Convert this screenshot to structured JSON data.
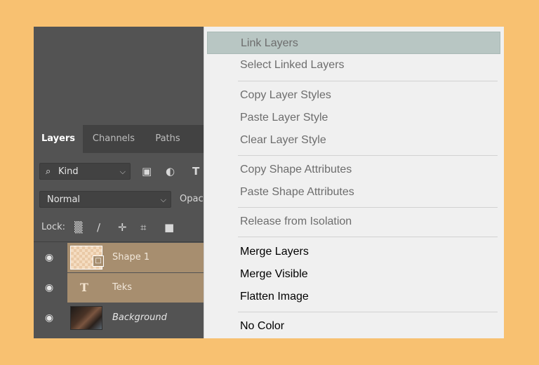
{
  "panel": {
    "tabs": [
      {
        "label": "Layers",
        "active": true
      },
      {
        "label": "Channels",
        "active": false
      },
      {
        "label": "Paths",
        "active": false
      }
    ],
    "filter": {
      "kind_label": "Kind",
      "icons": [
        "image-filter-icon",
        "adjustment-filter-icon",
        "type-filter-icon"
      ],
      "type_glyph": "T"
    },
    "blend_mode": "Normal",
    "opacity_label": "Opac",
    "lock_label": "Lock:",
    "lock_icons": [
      "lock-transparent-pixels-icon",
      "lock-image-pixels-icon",
      "lock-position-icon",
      "lock-artboard-icon",
      "lock-all-icon"
    ],
    "layers": [
      {
        "name": "Shape 1",
        "kind": "shape",
        "selected": true
      },
      {
        "name": "Teks",
        "kind": "text",
        "selected": true,
        "glyph": "T"
      },
      {
        "name": "Background",
        "kind": "image",
        "selected": false
      }
    ]
  },
  "menu": {
    "items": [
      {
        "label": "Link Layers",
        "enabled": false,
        "highlighted": true
      },
      {
        "label": "Select Linked Layers",
        "enabled": false
      },
      {
        "sep": true
      },
      {
        "label": "Copy Layer Styles",
        "enabled": false
      },
      {
        "label": "Paste Layer Style",
        "enabled": false
      },
      {
        "label": "Clear Layer Style",
        "enabled": false
      },
      {
        "sep": true
      },
      {
        "label": "Copy Shape Attributes",
        "enabled": false
      },
      {
        "label": "Paste Shape Attributes",
        "enabled": false
      },
      {
        "sep": true
      },
      {
        "label": "Release from Isolation",
        "enabled": false
      },
      {
        "sep": true
      },
      {
        "label": "Merge Layers",
        "enabled": true
      },
      {
        "label": "Merge Visible",
        "enabled": true
      },
      {
        "label": "Flatten Image",
        "enabled": true
      },
      {
        "sep": true
      },
      {
        "label": "No Color",
        "enabled": true
      }
    ]
  },
  "colors": {
    "background": "#f8c171",
    "panel": "#535353",
    "selected_layer": "#a78e6f",
    "menu": "#f0f0f0",
    "menu_highlight": "#b8c6c3"
  }
}
